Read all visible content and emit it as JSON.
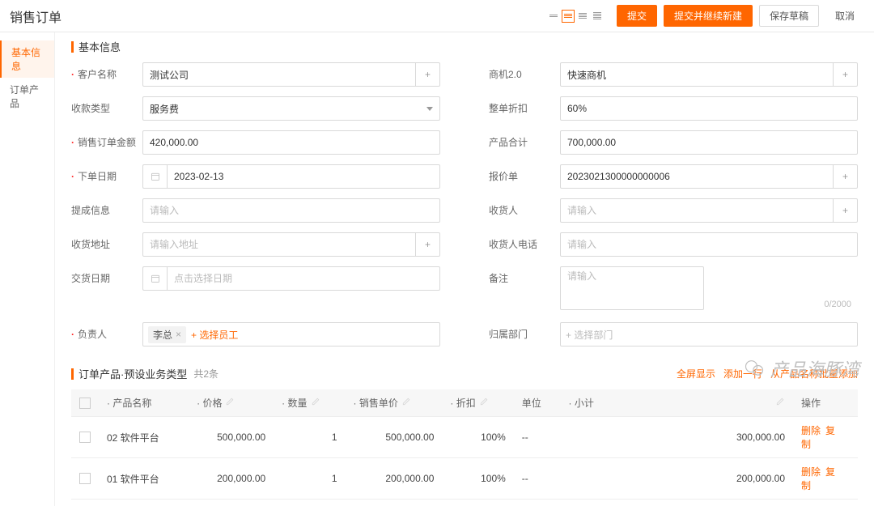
{
  "header": {
    "title": "销售订单",
    "submit": "提交",
    "submit_continue": "提交并继续新建",
    "save_draft": "保存草稿",
    "cancel": "取消"
  },
  "nav": {
    "basic": "基本信息",
    "products": "订单产品"
  },
  "section": {
    "basic_title": "基本信息",
    "product_title": "订单产品·预设业务类型",
    "product_count": "共2条",
    "fullscreen": "全屏显示",
    "add_row": "添加一行",
    "add_from_name": "从产品名称批量添加"
  },
  "labels": {
    "customer": "客户名称",
    "opportunity": "商机2.0",
    "pay_type": "收款类型",
    "discount": "整单折扣",
    "order_amount": "销售订单金额",
    "product_total": "产品合计",
    "order_date": "下单日期",
    "quote_no": "报价单",
    "commission": "提成信息",
    "receiver": "收货人",
    "ship_addr": "收货地址",
    "receiver_tel": "收货人电话",
    "delivery_date": "交货日期",
    "remark": "备注",
    "owner": "负责人",
    "dept": "归属部门"
  },
  "values": {
    "customer": "测试公司",
    "opportunity": "快速商机",
    "pay_type": "服务费",
    "discount": "60%",
    "order_amount": "420,000.00",
    "product_total": "700,000.00",
    "order_date": "2023-02-13",
    "quote_no": "2023021300000000006",
    "owner_tag": "李总"
  },
  "placeholders": {
    "input": "请输入",
    "addr": "请输入地址",
    "select_date": "点击选择日期",
    "select_emp": "+ 选择员工",
    "select_dept": "+ 选择部门"
  },
  "table": {
    "cols": {
      "name": "产品名称",
      "price": "价格",
      "qty": "数量",
      "unit_price": "销售单价",
      "disc": "折扣",
      "unit": "单位",
      "subtotal": "小计",
      "ops": "操作"
    },
    "ops": {
      "del": "删除",
      "copy": "复制"
    },
    "rows": [
      {
        "name": "02 软件平台",
        "price": "500,000.00",
        "qty": "1",
        "unit_price": "500,000.00",
        "disc": "100%",
        "unit": "--",
        "subtotal": "300,000.00"
      },
      {
        "name": "01 软件平台",
        "price": "200,000.00",
        "qty": "1",
        "unit_price": "200,000.00",
        "disc": "100%",
        "unit": "--",
        "subtotal": "200,000.00"
      }
    ]
  },
  "remark_counter": "0/2000",
  "watermark": "产品海豚湾"
}
